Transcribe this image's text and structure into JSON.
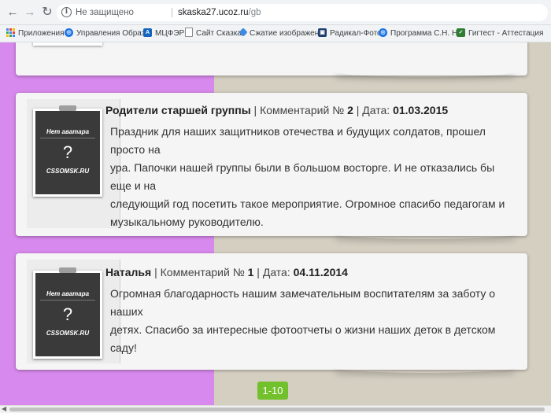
{
  "browser": {
    "security_label": "Не защищено",
    "url_host": "skaska27.ucoz.ru",
    "url_path": "/gb"
  },
  "bookmarks": [
    {
      "label": "Приложения",
      "icon": "apps-grid-icon"
    },
    {
      "label": "Управления Образо",
      "icon": "globe-icon"
    },
    {
      "label": "МЦФЭР",
      "icon": "letter-a-icon"
    },
    {
      "label": "Сайт Сказка",
      "icon": "page-icon"
    },
    {
      "label": "Сжатие изображени",
      "icon": "diamond-icon"
    },
    {
      "label": "Радикал-Фото",
      "icon": "photo-icon"
    },
    {
      "label": "Программа С.Н. Ни",
      "icon": "globe-icon"
    },
    {
      "label": "Гигтест - Аттестация",
      "icon": "shield-icon"
    }
  ],
  "comments": [
    {
      "author": "Родители старшей группы",
      "comment_label": "Комментарий №",
      "number": "2",
      "date_label": "Дата:",
      "date": "01.03.2015",
      "lines": [
        "Праздник для наших защитников отечества и будущих солдатов, прошел просто на",
        "ура. Папочки нашей группы были в большом восторге. И не отказались бы еще и на",
        "следующий год посетить такое мероприятие. Огромное спасибо педагогам и",
        "музыкальному руководителю."
      ]
    },
    {
      "author": "Наталья",
      "comment_label": "Комментарий №",
      "number": "1",
      "date_label": "Дата:",
      "date": "04.11.2014",
      "lines": [
        "Огромная благодарность нашим замечательным воспитателям за заботу о наших",
        "детях. Спасибо за интересные фотоотчеты о жизни наших деток в детском саду!"
      ]
    }
  ],
  "avatar": {
    "no_avatar": "Нет аватара",
    "placeholder": "?",
    "site": "CSSOMSK.RU"
  },
  "pager": {
    "label": "1-10"
  },
  "colors": {
    "left_band": "#d889ed",
    "page_bg": "#d5cfc2",
    "pager_bg": "#72c02c"
  }
}
